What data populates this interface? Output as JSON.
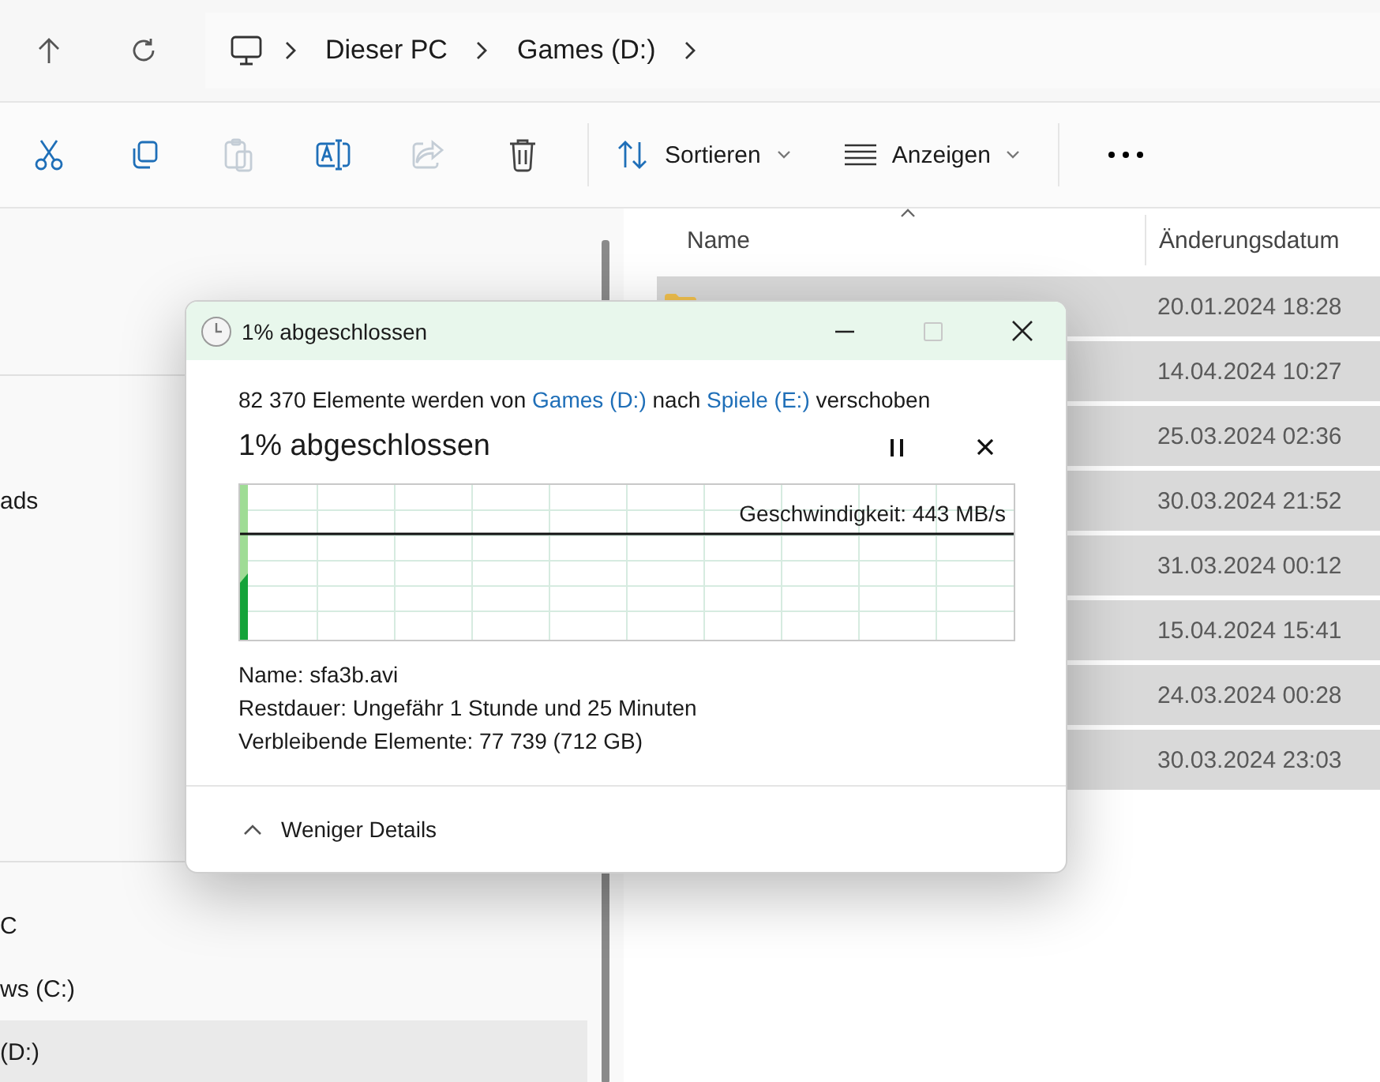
{
  "breadcrumb": [
    "Dieser PC",
    "Games (D:)"
  ],
  "toolbar": {
    "actions": [
      {
        "kind": "cut",
        "disabled": false
      },
      {
        "kind": "copy",
        "disabled": false
      },
      {
        "kind": "paste",
        "disabled": true
      },
      {
        "kind": "rename",
        "disabled": false
      },
      {
        "kind": "share",
        "disabled": true
      },
      {
        "kind": "delete",
        "disabled": false
      }
    ],
    "menus": [
      {
        "kind": "sort",
        "label": "Sortieren"
      },
      {
        "kind": "view",
        "label": "Anzeigen"
      }
    ]
  },
  "sidebar": {
    "sections": [
      {
        "items": [
          {
            "label": "ads",
            "selected": false
          }
        ]
      },
      {
        "items": [
          {
            "label": "C",
            "selected": false
          },
          {
            "label": "ws (C:)",
            "selected": false
          },
          {
            "label": "(D:)",
            "selected": true
          }
        ]
      }
    ]
  },
  "table": {
    "columns": [
      "Name",
      "Änderungsdatum"
    ],
    "rows": [
      {
        "kind": "folder",
        "date": "20.01.2024 18:28",
        "selected": true
      },
      {
        "date": "14.04.2024 10:27",
        "selected": true
      },
      {
        "date": "25.03.2024 02:36",
        "selected": true
      },
      {
        "date": "30.03.2024 21:52",
        "selected": true
      },
      {
        "date": "31.03.2024 00:12",
        "selected": true
      },
      {
        "date": "15.04.2024 15:41",
        "selected": true
      },
      {
        "date": "24.03.2024 00:28",
        "selected": true
      },
      {
        "date": "30.03.2024 23:03",
        "selected": true
      }
    ]
  },
  "dialog": {
    "title": "1% abgeschlossen",
    "summary": [
      {
        "text": "82 370 Elemente werden von "
      },
      {
        "text": "Games (D:)",
        "kind": "link"
      },
      {
        "text": " nach "
      },
      {
        "text": "Spiele (E:)",
        "kind": "link"
      },
      {
        "text": " verschoben"
      }
    ],
    "heading": "1% abgeschlossen",
    "speed": "Geschwindigkeit: 443 MB/s",
    "details": [
      "Name: sfa3b.avi",
      "Restdauer: Ungefähr 1 Stunde und 25 Minuten",
      "Verbleibende Elemente: 77 739 (712 GB)"
    ],
    "toggle": "Weniger Details"
  }
}
